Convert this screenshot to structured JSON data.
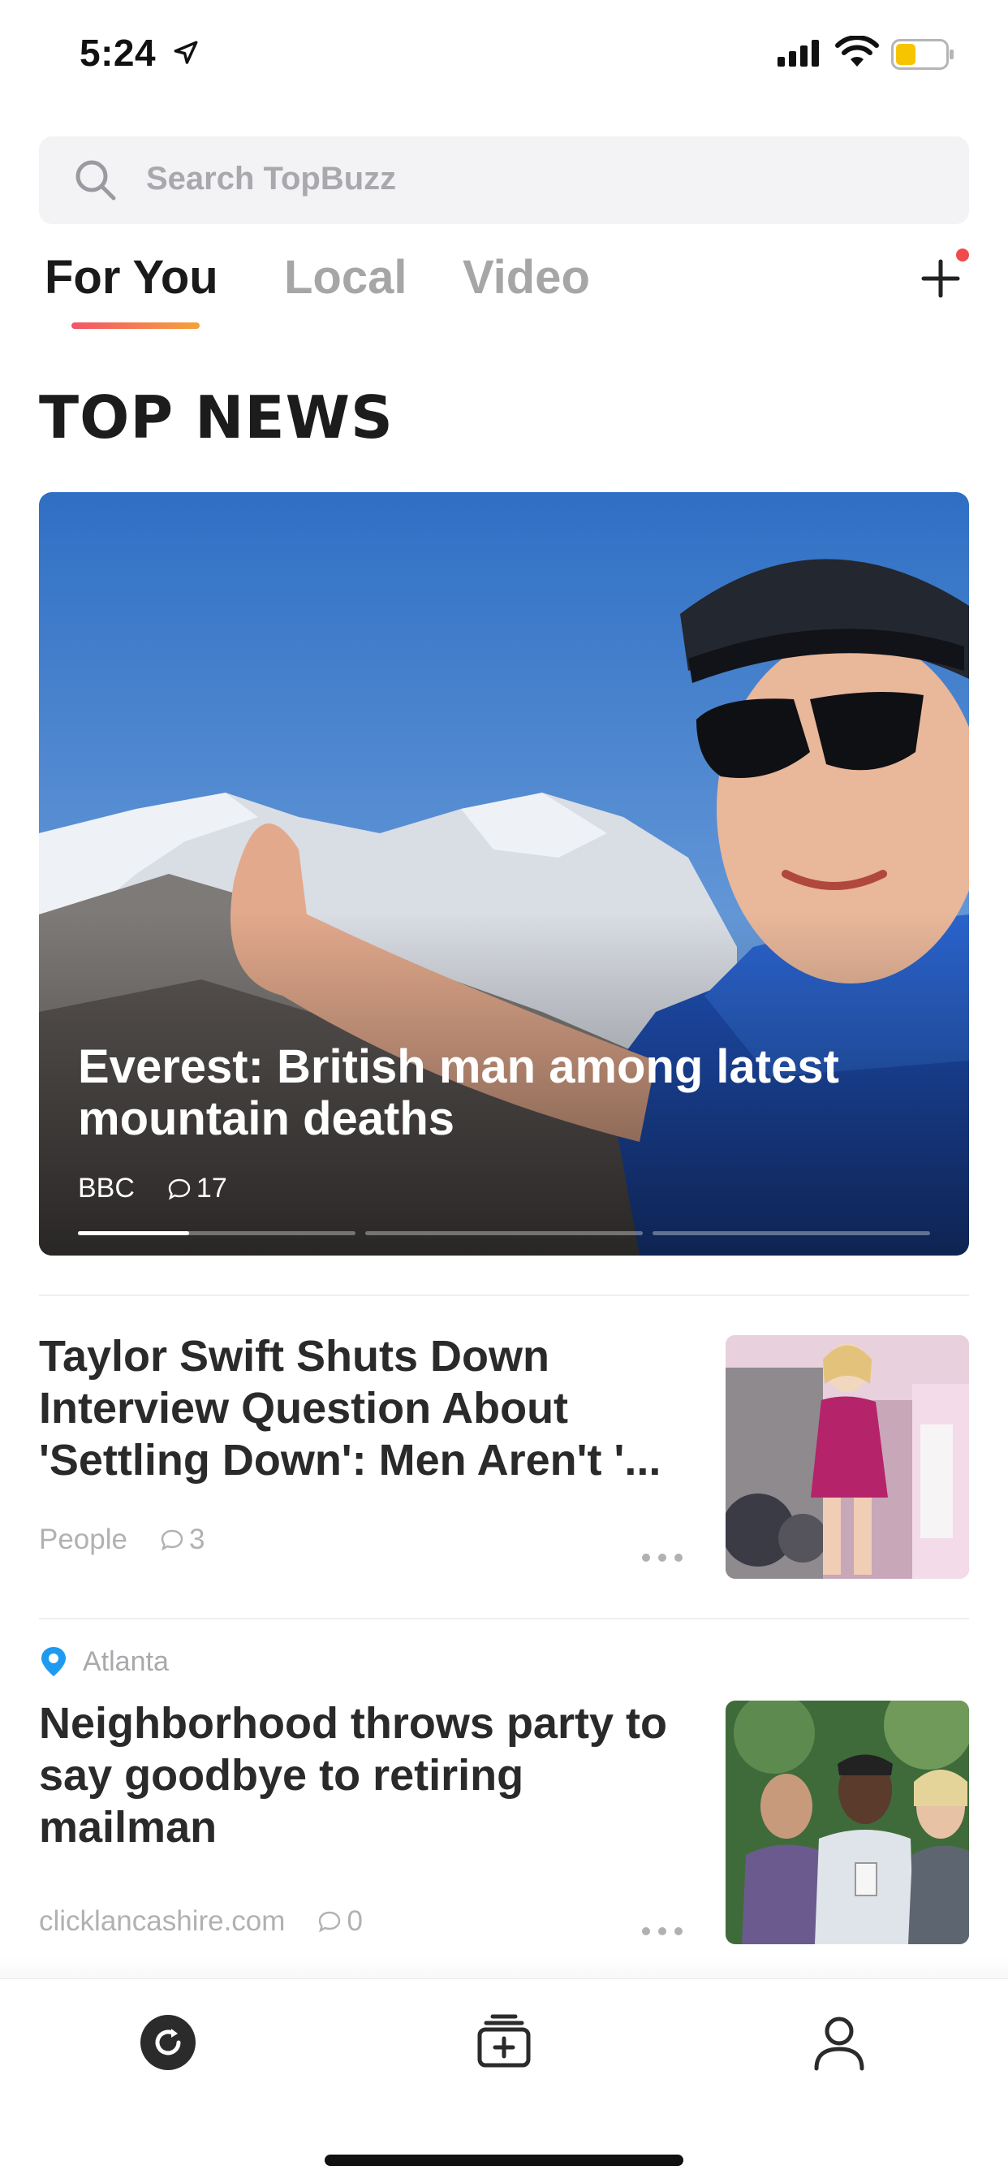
{
  "status_bar": {
    "time": "5:24"
  },
  "search": {
    "placeholder": "Search TopBuzz"
  },
  "tabs": [
    {
      "label": "For You",
      "active": true
    },
    {
      "label": "Local",
      "active": false
    },
    {
      "label": "Video",
      "active": false
    }
  ],
  "section": {
    "title": "TOP NEWS"
  },
  "hero": {
    "title": "Everest: British man among latest mountain deaths",
    "source": "BBC",
    "comments": "17",
    "carousel_count": 3,
    "carousel_active": 1
  },
  "articles": [
    {
      "title": "Taylor Swift Shuts Down Interview Question About 'Settling Down': Men Aren't '...",
      "source": "People",
      "comments": "3",
      "thumbnail": "performer-on-stage"
    },
    {
      "location": "Atlanta",
      "title": "Neighborhood throws party to say goodbye to retiring mailman",
      "source": "clicklancashire.com",
      "comments": "0",
      "thumbnail": "group-photo"
    }
  ],
  "colors": {
    "accent_gradient_start": "#f2566a",
    "accent_gradient_end": "#f4a23c",
    "notification_dot": "#f24a4a",
    "location_pin": "#1e9bf0",
    "battery_fill": "#f7c500"
  },
  "icons": {
    "refresh": "refresh-icon",
    "add_box": "add-box-icon",
    "profile": "profile-icon"
  }
}
